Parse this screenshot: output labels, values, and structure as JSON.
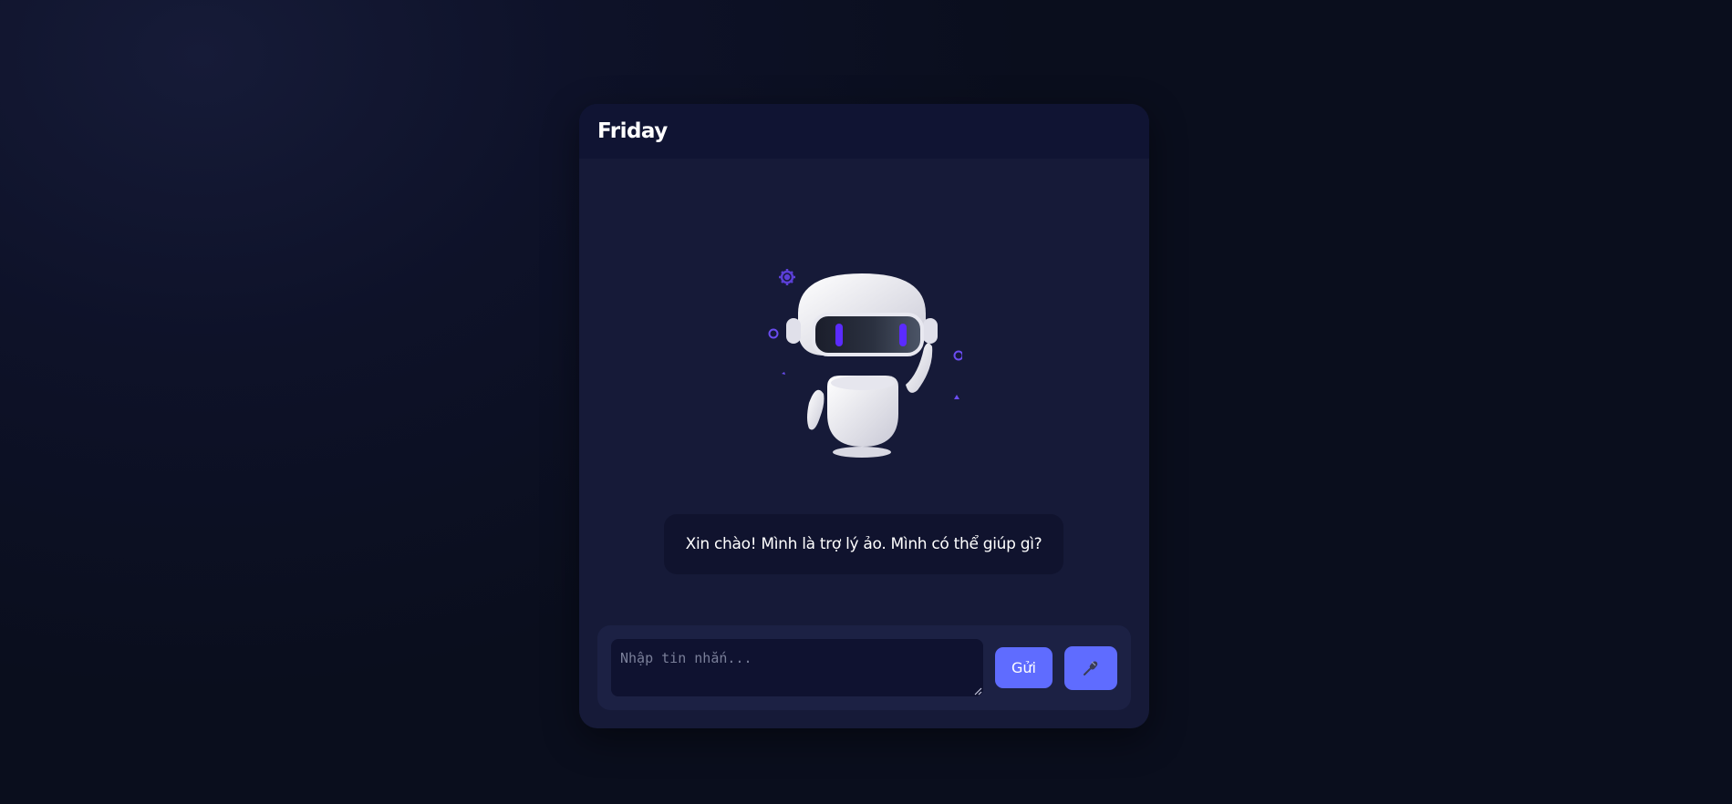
{
  "header": {
    "title": "Friday"
  },
  "messages": [
    {
      "sender": "bot",
      "text": "Xin chào! Mình là trợ lý ảo. Mình có thể giúp gì?"
    }
  ],
  "input": {
    "placeholder": "Nhập tin nhắn...",
    "value": ""
  },
  "send_button": {
    "label": "Gửi"
  },
  "mic_button": {
    "icon": "microphone-icon"
  },
  "avatar": {
    "icon": "robot-icon"
  },
  "colors": {
    "page_background": "#0b0f1f",
    "window_background": "#161a38",
    "header_background": "#101433",
    "bubble_background": "#10132e",
    "input_bar_background": "#1c2144",
    "input_background": "#0f1230",
    "accent": "#5f6cff",
    "robot_eye": "#5b2bff"
  }
}
